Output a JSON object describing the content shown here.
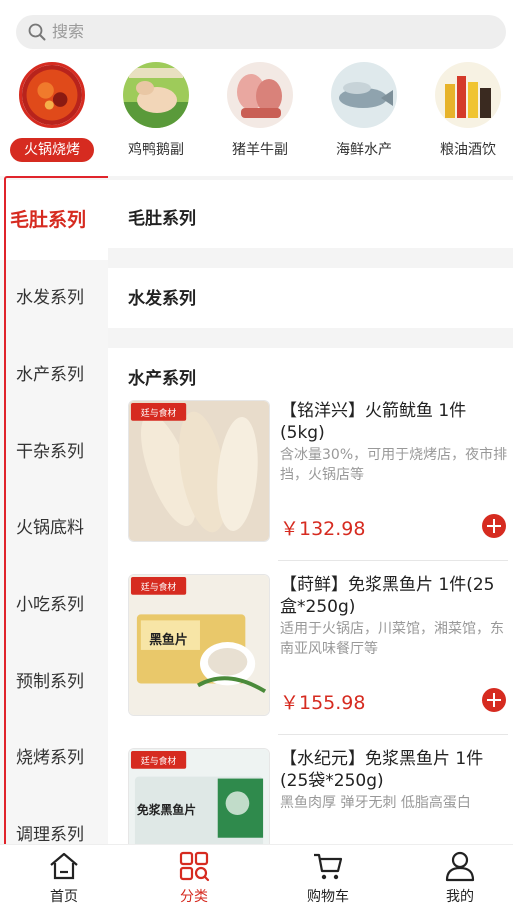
{
  "search": {
    "placeholder": "搜索"
  },
  "top_categories": [
    {
      "label": "火锅烧烤",
      "icon": "hotpot-image",
      "active": true
    },
    {
      "label": "鸡鸭鹅副",
      "icon": "poultry-image",
      "active": false
    },
    {
      "label": "猪羊牛副",
      "icon": "meat-image",
      "active": false
    },
    {
      "label": "海鲜水产",
      "icon": "seafood-image",
      "active": false
    },
    {
      "label": "粮油酒饮",
      "icon": "grain-oil-image",
      "active": false
    }
  ],
  "sidebar": {
    "items": [
      {
        "label": "毛肚系列",
        "active": true
      },
      {
        "label": "水发系列"
      },
      {
        "label": "水产系列"
      },
      {
        "label": "干杂系列"
      },
      {
        "label": "火锅底料"
      },
      {
        "label": "小吃系列"
      },
      {
        "label": "预制系列"
      },
      {
        "label": "烧烤系列"
      },
      {
        "label": "调理系列"
      }
    ]
  },
  "sections": [
    {
      "title": "毛肚系列"
    },
    {
      "title": "水发系列"
    },
    {
      "title": "水产系列"
    }
  ],
  "products": [
    {
      "badge": "廷与食材",
      "name": "【铭洋兴】火箭鱿鱼 1件(5kg)",
      "desc": "含冰量30%，可用于烧烤店，夜市排挡，火锅店等",
      "price": "￥132.98"
    },
    {
      "badge": "廷与食材",
      "name": "【莳鲜】免浆黑鱼片 1件(25盒*250g)",
      "desc": "适用于火锅店，川菜馆，湘菜馆，东南亚风味餐厅等",
      "price": "￥155.98",
      "package_text": "黑鱼片"
    },
    {
      "badge": "廷与食材",
      "name": "【水纪元】免浆黑鱼片 1件(25袋*250g)",
      "desc": "黑鱼肉厚 弹牙无刺 低脂高蛋白",
      "price": "",
      "package_text": "免浆黑鱼片"
    }
  ],
  "tabbar": [
    {
      "label": "首页",
      "icon": "home-icon",
      "active": false
    },
    {
      "label": "分类",
      "icon": "category-icon",
      "active": true
    },
    {
      "label": "购物车",
      "icon": "cart-icon",
      "active": false
    },
    {
      "label": "我的",
      "icon": "user-icon",
      "active": false
    }
  ],
  "colors": {
    "accent": "#d62b20",
    "sidebar_bg": "#f6f6f6",
    "outline": "#e0242b"
  }
}
